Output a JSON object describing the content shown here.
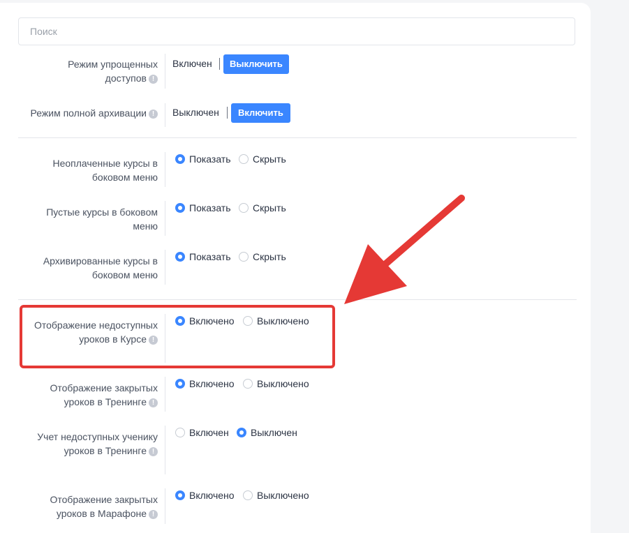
{
  "search": {
    "placeholder": "Поиск"
  },
  "access": {
    "simplified_label": "Режим упрощенных доступов",
    "simplified_status": "Включен",
    "simplified_button": "Выключить",
    "archive_label": "Режим полной архивации",
    "archive_status": "Выключен",
    "archive_button": "Включить"
  },
  "menu": {
    "unpaid_label": "Неоплаченные курсы в боковом меню",
    "empty_label": "Пустые курсы в боковом меню",
    "archived_label": "Архивированные курсы в боковом меню",
    "show": "Показать",
    "hide": "Скрыть"
  },
  "lessons": {
    "unavailable_course_label": "Отображение недоступных уроков в Курсе",
    "closed_training_label": "Отображение закрытых уроков в Тренинге",
    "count_unavailable_label": "Учет недоступных ученику уроков в Тренинге",
    "closed_marathon_label": "Отображение закрытых уроков в Марафоне",
    "enabled_n": "Включено",
    "disabled_n": "Выключено",
    "enabled_m": "Включен",
    "disabled_m": "Выключен"
  },
  "selected": {
    "unpaid": "Показать",
    "empty": "Показать",
    "archived": "Показать",
    "unavailable_course": "Включено",
    "closed_training": "Включено",
    "count_unavailable": "Выключен",
    "closed_marathon": "Включено"
  },
  "colors": {
    "accent": "#3a86ff",
    "annotation": "#e53935"
  }
}
